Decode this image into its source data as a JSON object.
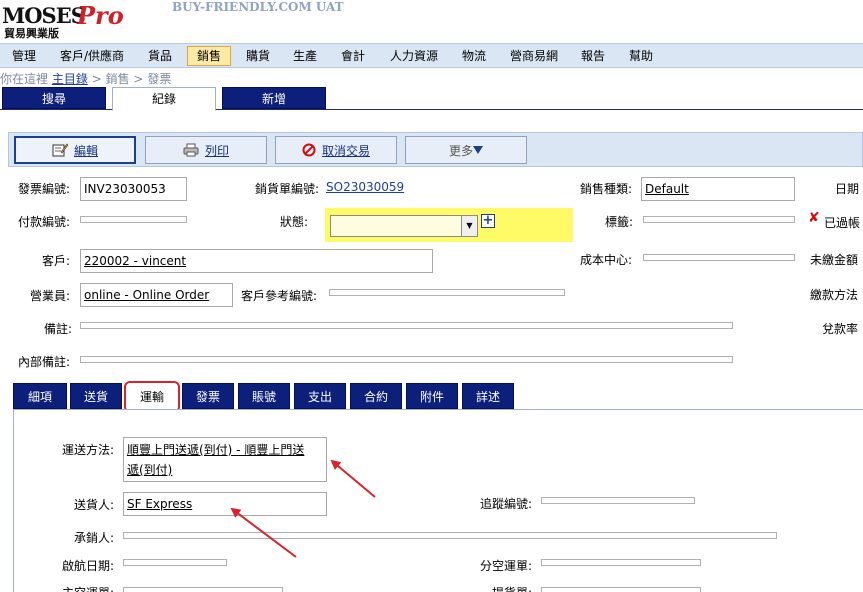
{
  "header": {
    "logo_text": "MOSES",
    "logo_pro": "Pro",
    "logo_sub": "貿易興業版",
    "site_title": "BUY-FRIENDLY.COM UAT"
  },
  "menu": [
    {
      "label": "管理"
    },
    {
      "label": "客戶/供應商"
    },
    {
      "label": "貨品"
    },
    {
      "label": "銷售"
    },
    {
      "label": "購貨"
    },
    {
      "label": "生產"
    },
    {
      "label": "會計"
    },
    {
      "label": "人力資源"
    },
    {
      "label": "物流"
    },
    {
      "label": "營商易網"
    },
    {
      "label": "報告"
    },
    {
      "label": "幫助"
    }
  ],
  "breadcrumb": {
    "prefix": "你在這裡",
    "home": "主目錄",
    "sep1": ">",
    "level1": "銷售",
    "sep2": ">",
    "level2": "發票"
  },
  "top_tabs": [
    {
      "label": "搜尋"
    },
    {
      "label": "紀錄"
    },
    {
      "label": "新增"
    }
  ],
  "toolbar": {
    "edit": "編輯",
    "print": "列印",
    "cancel": "取消交易",
    "more": "更多"
  },
  "form": {
    "invoice_no_label": "發票編號:",
    "invoice_no_value": "INV23030053",
    "so_no_label": "銷貨單編號:",
    "so_no_value": "SO23030059",
    "sales_type_label": "銷售種類:",
    "sales_type_value": "Default",
    "date_label": "日期",
    "payment_no_label": "付款編號:",
    "status_label": "狀態:",
    "tag_label": "標籤:",
    "expired_label": "已過帳",
    "customer_label": "客戶:",
    "customer_value": "220002 - vincent",
    "cost_center_label": "成本中心:",
    "unpaid_label": "未繳金額",
    "salesperson_label": "營業員:",
    "salesperson_value": "online - Online Order",
    "cust_ref_label": "客戶參考編號:",
    "payment_method_label": "繳款方法",
    "remarks_label": "備註:",
    "exchange_label": "兌款率",
    "internal_remarks_label": "內部備註:"
  },
  "sub_tabs": [
    {
      "label": "細項"
    },
    {
      "label": "送貨"
    },
    {
      "label": "運輸"
    },
    {
      "label": "發票"
    },
    {
      "label": "賬號"
    },
    {
      "label": "支出"
    },
    {
      "label": "合約"
    },
    {
      "label": "附件"
    },
    {
      "label": "詳述"
    }
  ],
  "shipping": {
    "method_label": "運送方法:",
    "method_value_line1": "順豐上門送遞(到付) - 順豐上門送",
    "method_value_line2": "遞(到付)",
    "carrier_label": "送貨人:",
    "carrier_value": "SF Express",
    "tracking_label": "追蹤編號:",
    "forwarder_label": "承銷人:",
    "departure_label": "啟航日期:",
    "sub_awb_label": "分空運單:",
    "master_awb_label": "主空運單:",
    "bol_label": "提貨單:"
  },
  "colors": {
    "menubar": "#dbe6f4",
    "tab_dark": "#0c1f7a",
    "highlight": "#fffb66",
    "annotation": "#d8232a"
  }
}
